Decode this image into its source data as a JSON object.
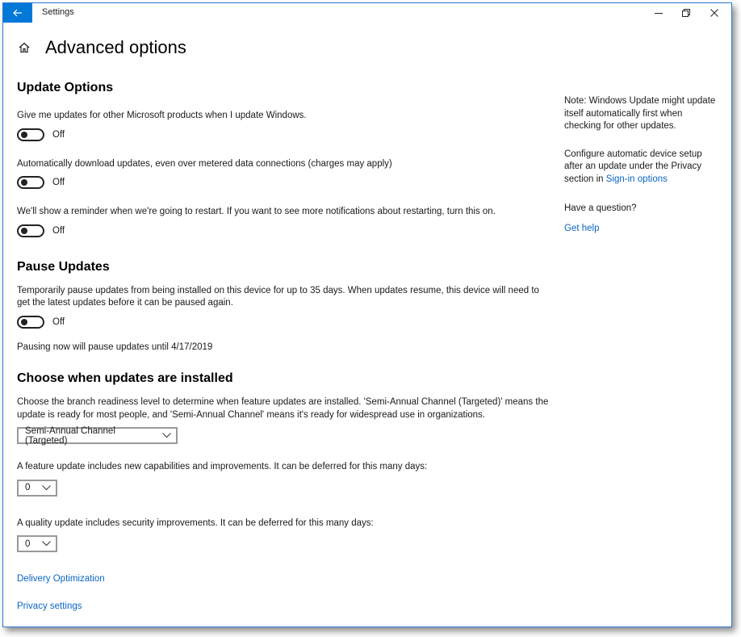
{
  "titlebar": {
    "title": "Settings",
    "back_icon": "back-arrow-icon",
    "controls": [
      "minimize-icon",
      "restore-icon",
      "close-icon"
    ]
  },
  "header": {
    "title": "Advanced options",
    "home_icon": "home-icon"
  },
  "update_options": {
    "heading": "Update Options",
    "items": [
      {
        "label": "Give me updates for other Microsoft products when I update Windows.",
        "state": "Off"
      },
      {
        "label": "Automatically download updates, even over metered data connections (charges may apply)",
        "state": "Off"
      },
      {
        "label": "We'll show a reminder when we're going to restart. If you want to see more notifications about restarting, turn this on.",
        "state": "Off"
      }
    ]
  },
  "pause_updates": {
    "heading": "Pause Updates",
    "description": "Temporarily pause updates from being installed on this device for up to 35 days. When updates resume, this device will need to get the latest updates before it can be paused again.",
    "state": "Off",
    "note": "Pausing now will pause updates until 4/17/2019"
  },
  "choose": {
    "heading": "Choose when updates are installed",
    "description": "Choose the branch readiness level to determine when feature updates are installed. 'Semi-Annual Channel (Targeted)' means the update is ready for most people, and 'Semi-Annual Channel' means it's ready for widespread use in organizations.",
    "channel_value": "Semi-Annual Channel (Targeted)",
    "feature_label": "A feature update includes new capabilities and improvements. It can be deferred for this many days:",
    "feature_value": "0",
    "quality_label": "A quality update includes security improvements. It can be deferred for this many days:",
    "quality_value": "0"
  },
  "links": {
    "delivery": "Delivery Optimization",
    "privacy": "Privacy settings"
  },
  "sidebar": {
    "note": "Note: Windows Update might update itself automatically first when checking for other updates.",
    "configure_text": "Configure automatic device setup after an update under the Privacy section in ",
    "signin_link": "Sign-in options",
    "question": "Have a question?",
    "help_link": "Get help"
  },
  "colors": {
    "accent": "#0078d7",
    "link": "#0a66c2"
  }
}
